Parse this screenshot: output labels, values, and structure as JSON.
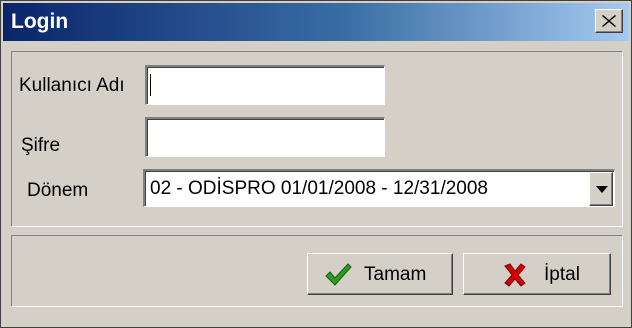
{
  "window": {
    "title": "Login",
    "close_icon": "close-icon"
  },
  "form": {
    "username_label": "Kullanıcı Adı",
    "username_value": "",
    "password_label": "Şifre",
    "password_value": "",
    "period_label": "Dönem",
    "period_selected": "02 - ODİSPRO  01/01/2008 - 12/31/2008"
  },
  "buttons": {
    "ok_label": "Tamam",
    "ok_icon": "checkmark-icon",
    "cancel_label": "İptal",
    "cancel_icon": "red-x-icon"
  },
  "colors": {
    "title_gradient_start": "#0a246a",
    "title_gradient_end": "#a6caf0",
    "check_green": "#2e9b1f",
    "cancel_red": "#d00000"
  }
}
